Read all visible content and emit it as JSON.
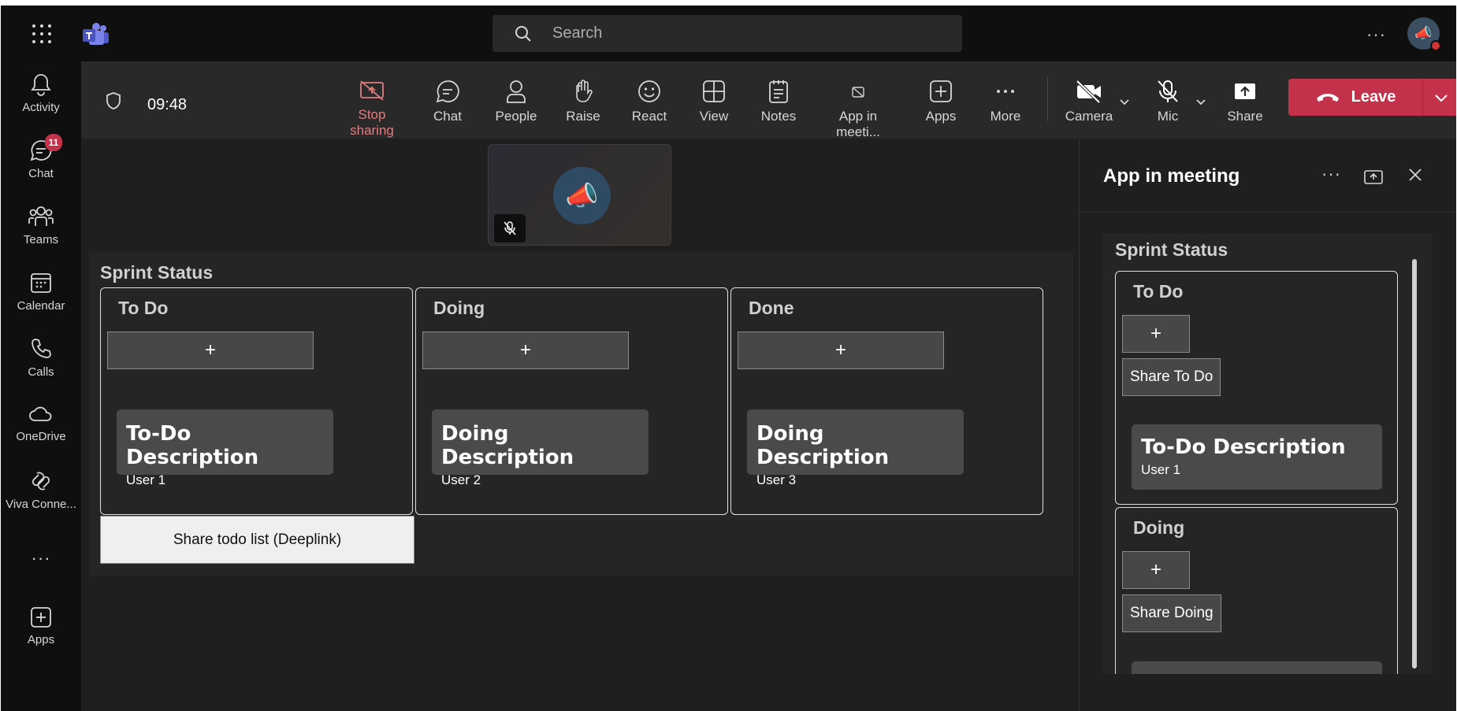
{
  "topbar": {
    "search_placeholder": "Search",
    "more_label": "···"
  },
  "rail": {
    "items": [
      {
        "label": "Activity",
        "icon": "bell-icon"
      },
      {
        "label": "Chat",
        "icon": "chat-icon",
        "badge": "11"
      },
      {
        "label": "Teams",
        "icon": "teams-icon"
      },
      {
        "label": "Calendar",
        "icon": "calendar-icon"
      },
      {
        "label": "Calls",
        "icon": "phone-icon"
      },
      {
        "label": "OneDrive",
        "icon": "cloud-icon"
      },
      {
        "label": "Viva Conne...",
        "icon": "viva-icon"
      },
      {
        "label": "···",
        "icon": "more-icon"
      },
      {
        "label": "Apps",
        "icon": "add-app-icon"
      }
    ]
  },
  "meeting_toolbar": {
    "time": "09:48",
    "buttons": {
      "stop_sharing": "Stop sharing",
      "chat": "Chat",
      "people": "People",
      "raise": "Raise",
      "react": "React",
      "view": "View",
      "notes": "Notes",
      "app_in_meeting": "App in meeti...",
      "apps": "Apps",
      "more": "More",
      "camera": "Camera",
      "mic": "Mic",
      "share": "Share"
    },
    "leave": "Leave"
  },
  "board": {
    "title": "Sprint Status",
    "columns": [
      {
        "title": "To Do",
        "add": "+",
        "card_title": "To-Do Description",
        "card_user": "User 1"
      },
      {
        "title": "Doing",
        "add": "+",
        "card_title": "Doing Description",
        "card_user": "User 2"
      },
      {
        "title": "Done",
        "add": "+",
        "card_title": "Doing Description",
        "card_user": "User 3"
      }
    ],
    "share_button": "Share todo list (Deeplink)"
  },
  "panel": {
    "title": "App in meeting",
    "more": "···",
    "app_title": "Sprint Status",
    "columns": [
      {
        "title": "To Do",
        "add": "+",
        "share": "Share To Do",
        "card_title": "To-Do Description",
        "card_user": "User 1"
      },
      {
        "title": "Doing",
        "add": "+",
        "share": "Share Doing"
      }
    ]
  },
  "colors": {
    "leave": "#c4314b",
    "stop_sharing": "#e37d80",
    "active_underline": "#7f85f5",
    "badge": "#c4314b"
  }
}
